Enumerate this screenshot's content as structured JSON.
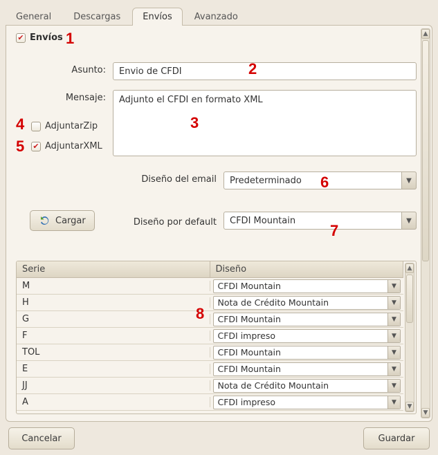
{
  "tabs": {
    "general": "General",
    "descargas": "Descargas",
    "envios": "Envíos",
    "avanzado": "Avanzado",
    "active": "envios"
  },
  "envios": {
    "section_checkbox_label": "Envíos",
    "section_checked": true,
    "asunto_label": "Asunto:",
    "asunto_value": "Envio de CFDI",
    "mensaje_label": "Mensaje:",
    "mensaje_value": "Adjunto el CFDI en formato XML",
    "adjuntar_zip_label": "AdjuntarZip",
    "adjuntar_zip_checked": false,
    "adjuntar_xml_label": "AdjuntarXML",
    "adjuntar_xml_checked": true,
    "diseno_email_label": "Diseño del email",
    "diseno_email_value": "Predeterminado",
    "cargar_label": "Cargar",
    "diseno_default_label": "Diseño por default",
    "diseno_default_value": "CFDI Mountain",
    "table": {
      "col_serie": "Serie",
      "col_diseno": "Diseño",
      "rows": [
        {
          "serie": "M",
          "diseno": "CFDI Mountain"
        },
        {
          "serie": "H",
          "diseno": "Nota de Crédito Mountain"
        },
        {
          "serie": "G",
          "diseno": "CFDI Mountain"
        },
        {
          "serie": "F",
          "diseno": "CFDI impreso"
        },
        {
          "serie": "TOL",
          "diseno": "CFDI Mountain"
        },
        {
          "serie": "E",
          "diseno": "CFDI Mountain"
        },
        {
          "serie": "JJ",
          "diseno": "Nota de Crédito Mountain"
        },
        {
          "serie": "A",
          "diseno": "CFDI impreso"
        }
      ]
    }
  },
  "footer": {
    "cancel": "Cancelar",
    "save": "Guardar"
  },
  "annotations": [
    "1",
    "2",
    "3",
    "4",
    "5",
    "6",
    "7",
    "8"
  ]
}
